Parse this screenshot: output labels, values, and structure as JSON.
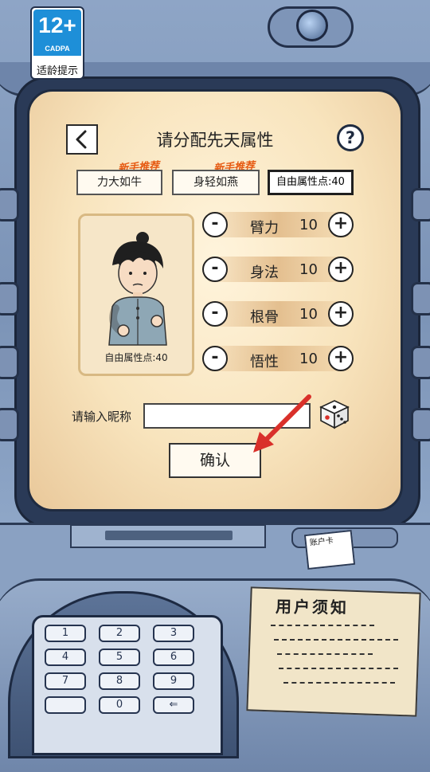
{
  "age_rating": {
    "number": "12+",
    "org": "CADPA",
    "label": "适龄提示"
  },
  "header": {
    "title": "请分配先天属性",
    "back_icon": "chevron-left-icon",
    "help_label": "?"
  },
  "presets": [
    {
      "label": "力大如牛",
      "tag": "新手推荐"
    },
    {
      "label": "身轻如燕",
      "tag": "新手推荐"
    }
  ],
  "free_points_label": "自由属性点:40",
  "character_card": {
    "points_label": "自由属性点:40"
  },
  "stats": [
    {
      "name": "臂力",
      "value": "10",
      "minus": "-",
      "plus": "+"
    },
    {
      "name": "身法",
      "value": "10",
      "minus": "-",
      "plus": "+"
    },
    {
      "name": "根骨",
      "value": "10",
      "minus": "-",
      "plus": "+"
    },
    {
      "name": "悟性",
      "value": "10",
      "minus": "-",
      "plus": "+"
    }
  ],
  "nickname": {
    "label": "请输入昵称",
    "value": "",
    "placeholder": ""
  },
  "confirm_label": "确认",
  "keypad": {
    "keys": [
      "1",
      "2",
      "3",
      "4",
      "5",
      "6",
      "7",
      "8",
      "9",
      "",
      "0",
      "⇐"
    ]
  },
  "notice": {
    "title": "用户须知"
  },
  "card_slot_text": "账户卡",
  "colors": {
    "accent_orange": "#e65a12",
    "atm_blue": "#7b93b6",
    "screen_cream": "#f8e4bd",
    "arrow_red": "#d9302a"
  }
}
